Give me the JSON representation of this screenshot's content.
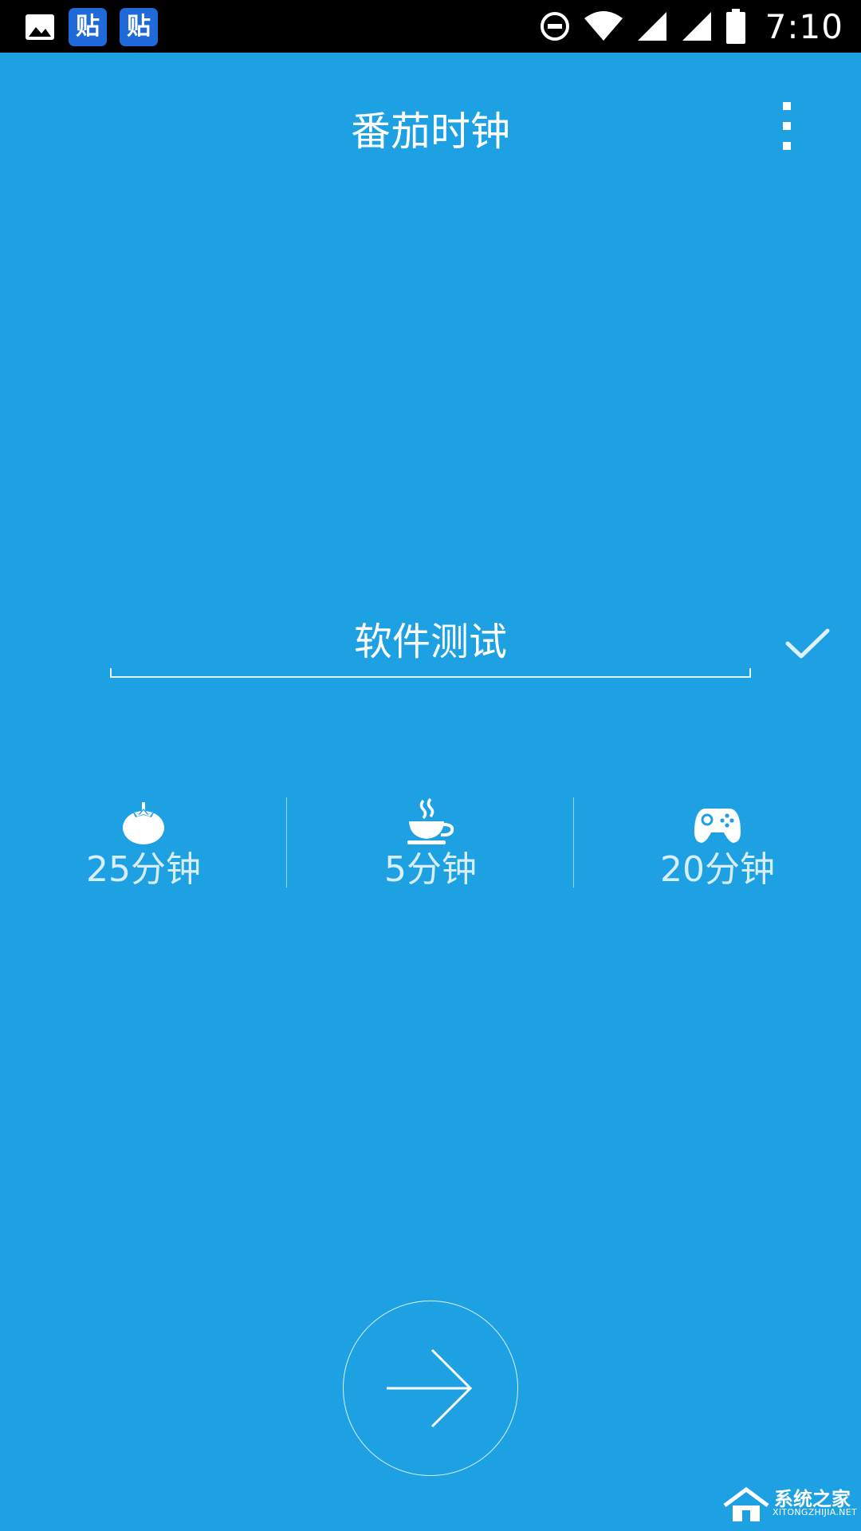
{
  "status_bar": {
    "time": "7:10",
    "notification_icons": [
      "image-icon",
      "tieba-icon",
      "tieba-icon"
    ],
    "tieba_glyph": "贴",
    "system_icons": [
      "do-not-disturb-icon",
      "wifi-icon",
      "signal-icon",
      "signal-icon",
      "battery-icon"
    ]
  },
  "app_bar": {
    "title": "番茄时钟",
    "menu_icon": "more-vert-icon"
  },
  "task": {
    "value": "软件测试",
    "confirm_icon": "check-icon"
  },
  "durations": [
    {
      "icon": "tomato-icon",
      "label": "25分钟"
    },
    {
      "icon": "coffee-icon",
      "label": "5分钟"
    },
    {
      "icon": "gamepad-icon",
      "label": "20分钟"
    }
  ],
  "start_button": {
    "icon": "arrow-right-icon"
  },
  "watermark": {
    "title": "系统之家",
    "subtitle": "XITONGZHIJIA.NET"
  },
  "colors": {
    "background": "#1ea1e2",
    "status_bar": "#000000",
    "tieba_badge": "#1f69d8"
  }
}
